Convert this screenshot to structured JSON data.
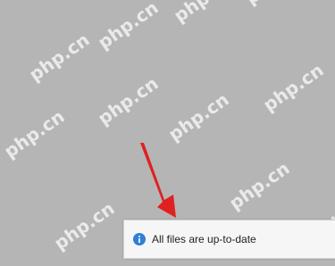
{
  "background_color": "#b5b5b5",
  "watermark_text": "php.cn",
  "notification": {
    "message": "All files are up-to-date",
    "icon": "info-icon",
    "icon_color": "#2f7fd6"
  },
  "annotation": {
    "type": "arrow",
    "color": "#e02020"
  }
}
